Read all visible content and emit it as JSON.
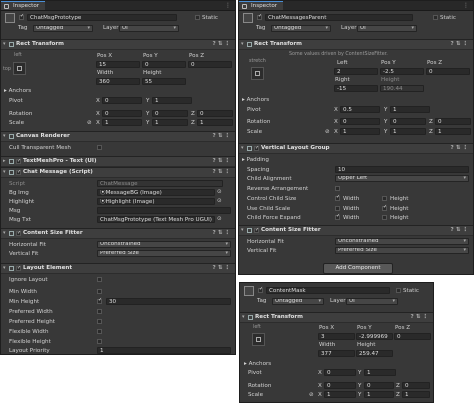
{
  "left": {
    "tab": "Inspector",
    "object_name": "ChatMsgPrototype",
    "static_label": "Static",
    "tag_label": "Tag",
    "tag_value": "Untagged",
    "layer_label": "Layer",
    "layer_value": "UI",
    "rect_transform": {
      "title": "Rect Transform",
      "anchor_h": "left",
      "anchor_v": "top",
      "pos_x_label": "Pos X",
      "pos_y_label": "Pos Y",
      "pos_z_label": "Pos Z",
      "pos_x": "15",
      "pos_y": "0",
      "pos_z": "0",
      "width_label": "Width",
      "height_label": "Height",
      "width": "360",
      "height": "55",
      "anchors_label": "Anchors",
      "pivot_label": "Pivot",
      "pivot_x": "0",
      "pivot_y": "1",
      "rotation_label": "Rotation",
      "rot_x": "0",
      "rot_y": "0",
      "rot_z": "0",
      "scale_label": "Scale",
      "scale_x": "1",
      "scale_y": "1",
      "scale_z": "1"
    },
    "canvas_renderer": {
      "title": "Canvas Renderer",
      "cull_label": "Cull Transparent Mesh"
    },
    "textmeshpro": {
      "title": "TextMeshPro - Text (UI)"
    },
    "chat_message": {
      "title": "Chat Message (Script)",
      "script_label": "Script",
      "script_value": "ChatMessage",
      "bg_label": "Bg Img",
      "bg_value": "⦿MessageBG (Image)",
      "highlight_label": "Highlight",
      "highlight_value": "⦿Highlight (Image)",
      "msg_label": "Msg",
      "msgtxt_label": "Msg Txt",
      "msgtxt_value": "ChatMsgPrototype (Text Mesh Pro UGUI)"
    },
    "content_size_fitter": {
      "title": "Content Size Fitter",
      "hfit_label": "Horizontal Fit",
      "hfit_value": "Unconstrained",
      "vfit_label": "Vertical Fit",
      "vfit_value": "Preferred Size"
    },
    "layout_element": {
      "title": "Layout Element",
      "ignore_label": "Ignore Layout",
      "min_width_label": "Min Width",
      "min_height_label": "Min Height",
      "min_height_value": "30",
      "pref_width_label": "Preferred Width",
      "pref_height_label": "Preferred Height",
      "flex_width_label": "Flexible Width",
      "flex_height_label": "Flexible Height",
      "priority_label": "Layout Priority",
      "priority_value": "1"
    }
  },
  "right": {
    "tab": "Inspector",
    "object_name": "ChatMessagesParent",
    "static_label": "Static",
    "tag_label": "Tag",
    "tag_value": "Untagged",
    "layer_label": "Layer",
    "layer_value": "UI",
    "rect_transform": {
      "title": "Rect Transform",
      "driven_note": "Some values driven by ContentSizeFitter.",
      "anchor_h": "stretch",
      "left_label": "Left",
      "pos_y_label": "Pos Y",
      "pos_z_label": "Pos Z",
      "left": "2",
      "pos_y": "-2.5",
      "pos_z": "0",
      "right_label": "Right",
      "height_label": "Height",
      "right": "-15",
      "height": "190.44",
      "anchors_label": "Anchors",
      "pivot_label": "Pivot",
      "pivot_x": "0.5",
      "pivot_y": "1",
      "rotation_label": "Rotation",
      "rot_x": "0",
      "rot_y": "0",
      "rot_z": "0",
      "scale_label": "Scale",
      "scale_x": "1",
      "scale_y": "1",
      "scale_z": "1"
    },
    "vlg": {
      "title": "Vertical Layout Group",
      "padding_label": "Padding",
      "spacing_label": "Spacing",
      "spacing_value": "10",
      "child_align_label": "Child Alignment",
      "child_align_value": "Upper Left",
      "reverse_label": "Reverse Arrangement",
      "ccs_label": "Control Child Size",
      "ucs_label": "Use Child Scale",
      "cfe_label": "Child Force Expand",
      "width_label": "Width",
      "height_label": "Height"
    },
    "content_size_fitter": {
      "title": "Content Size Fitter",
      "hfit_label": "Horizontal Fit",
      "hfit_value": "Unconstrained",
      "vfit_label": "Vertical Fit",
      "vfit_value": "Preferred Size"
    },
    "add_component": "Add Component"
  },
  "mask": {
    "object_name": "ContentMask",
    "static_label": "Static",
    "tag_label": "Tag",
    "tag_value": "Untagged",
    "layer_label": "Layer",
    "layer_value": "UI",
    "rect_transform": {
      "title": "Rect Transform",
      "anchor_h": "left",
      "pos_x_label": "Pos X",
      "pos_y_label": "Pos Y",
      "pos_z_label": "Pos Z",
      "pos_x": "3",
      "pos_y": "-2.999969",
      "pos_z": "0",
      "width_label": "Width",
      "height_label": "Height",
      "width": "377",
      "height": "259.47",
      "anchors_label": "Anchors",
      "pivot_label": "Pivot",
      "pivot_x": "0",
      "pivot_y": "1",
      "rotation_label": "Rotation",
      "rot_x": "0",
      "rot_y": "0",
      "rot_z": "0",
      "scale_label": "Scale",
      "scale_x": "1",
      "scale_y": "1",
      "scale_z": "1"
    }
  },
  "glyphs": {
    "x": "X",
    "y": "Y",
    "z": "Z",
    "r": "R"
  }
}
